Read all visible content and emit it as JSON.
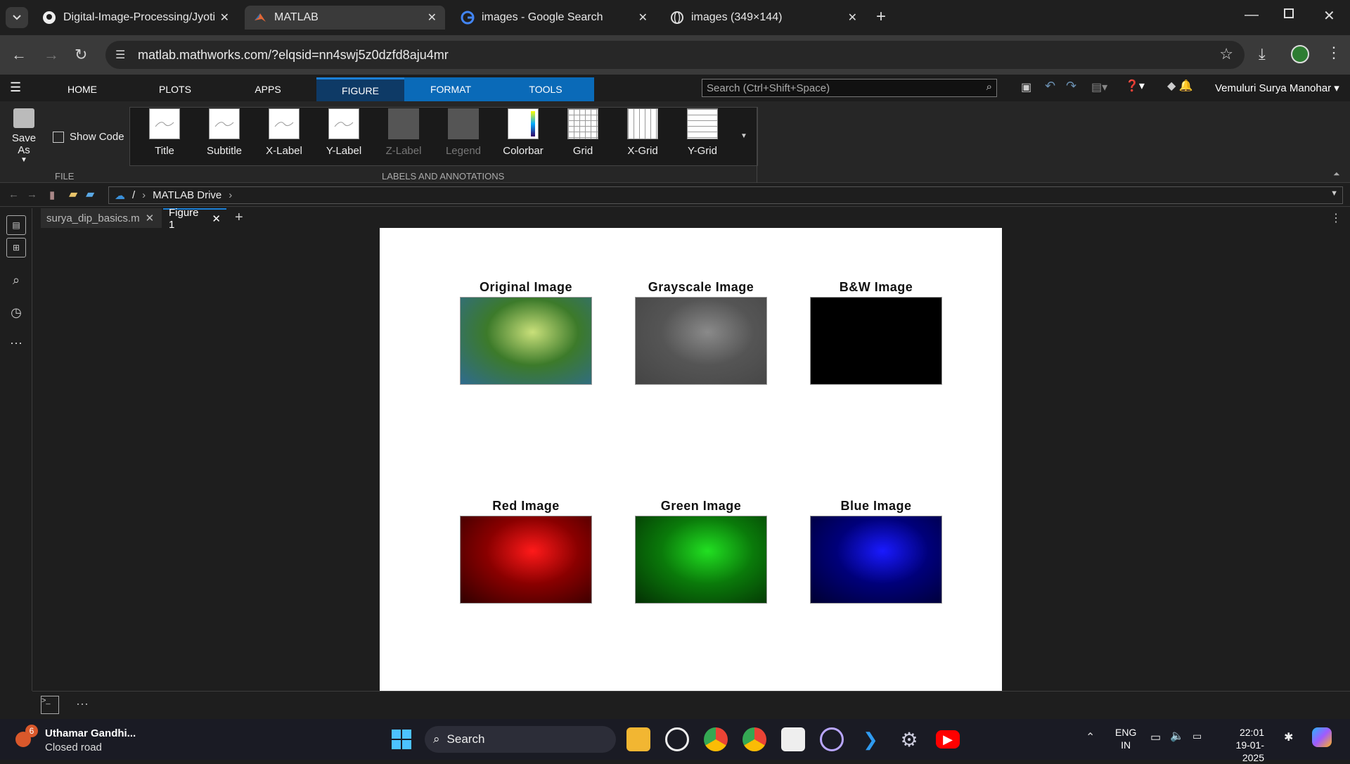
{
  "browser": {
    "tabs": [
      {
        "title": "Digital-Image-Processing/Jyotir",
        "icon": "github-icon"
      },
      {
        "title": "MATLAB",
        "icon": "matlab-icon",
        "active": true
      },
      {
        "title": "images - Google Search",
        "icon": "google-icon"
      },
      {
        "title": "images (349×144)",
        "icon": "globe-icon"
      }
    ],
    "url": "matlab.mathworks.com/?elqsid=nn4swj5z0dzfd8aju4mr"
  },
  "matlab": {
    "tabs": [
      "HOME",
      "PLOTS",
      "APPS",
      "FIGURE",
      "FORMAT",
      "TOOLS"
    ],
    "active_tab": "FIGURE",
    "search_placeholder": "Search (Ctrl+Shift+Space)",
    "user": "Vemuluri Surya Manohar",
    "ribbon": {
      "save_as": "Save As",
      "show_code": "Show Code",
      "file_section": "FILE",
      "annotations_section": "LABELS AND ANNOTATIONS",
      "buttons": [
        "Title",
        "Subtitle",
        "X-Label",
        "Y-Label",
        "Z-Label",
        "Legend",
        "Colorbar",
        "Grid",
        "X-Grid",
        "Y-Grid"
      ]
    },
    "path": {
      "root": "/",
      "folder": "MATLAB Drive"
    },
    "doc_tabs": [
      "surya_dip_basics.m",
      "Figure 1"
    ],
    "figure": {
      "subplots": [
        {
          "title": "Original Image",
          "colors": [
            "#3c7a2a",
            "#c9e07a",
            "#2f6b8f"
          ]
        },
        {
          "title": "Grayscale Image",
          "colors": [
            "#555555",
            "#8a8a8a",
            "#444444"
          ]
        },
        {
          "title": "B&W Image",
          "colors": [
            "#000000",
            "#000000",
            "#000000"
          ]
        },
        {
          "title": "Red Image",
          "colors": [
            "#8a0000",
            "#ff1a1a",
            "#300000"
          ]
        },
        {
          "title": "Green Image",
          "colors": [
            "#0a7a0a",
            "#22e022",
            "#043004"
          ]
        },
        {
          "title": "Blue Image",
          "colors": [
            "#00007a",
            "#1a1aff",
            "#000030"
          ]
        }
      ]
    }
  },
  "taskbar": {
    "weather_title": "Uthamar Gandhi...",
    "weather_sub": "Closed road",
    "weather_badge": "6",
    "search_label": "Search",
    "lang_top": "ENG",
    "lang_bottom": "IN",
    "time": "22:01",
    "date": "19-01-2025"
  }
}
